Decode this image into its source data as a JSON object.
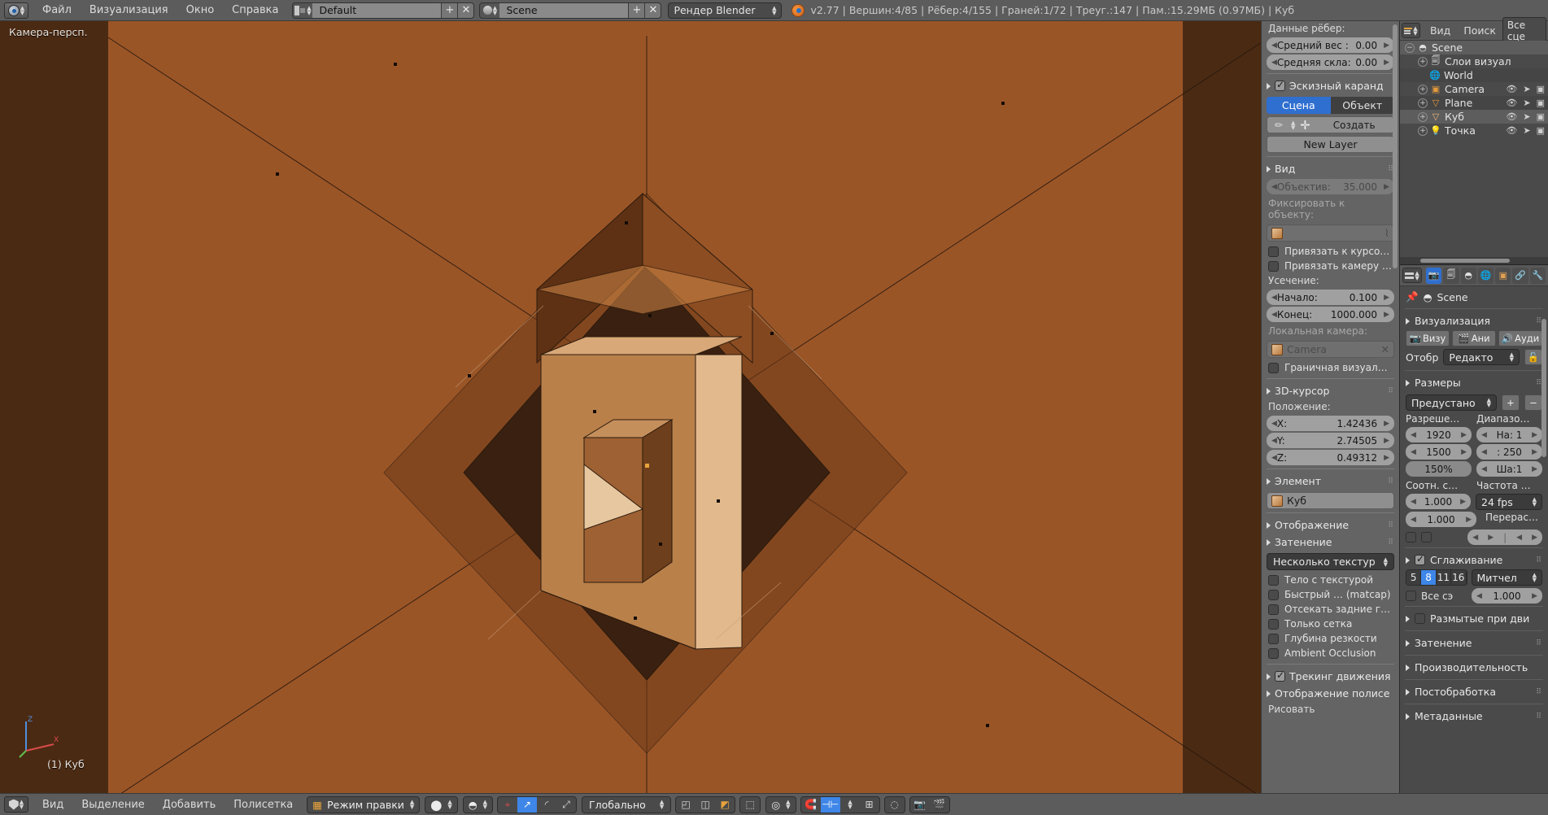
{
  "topbar": {
    "app_icon": "blender-icon",
    "menus": [
      "Файл",
      "Визуализация",
      "Окно",
      "Справка"
    ],
    "screen_layout": {
      "icon": "layout-icon",
      "value": "Default",
      "add": "+",
      "remove": "✕"
    },
    "scene_selector": {
      "icon": "scene-icon",
      "value": "Scene",
      "add": "+",
      "remove": "✕"
    },
    "render_engine": {
      "value": "Рендер Blender",
      "arrow": "⇅"
    },
    "stats": "v2.77 | Вершин:4/85 | Рёбер:4/155 | Граней:1/72 | Треуг.:147 | Пам.:15.29МБ (0.97МБ) | Куб"
  },
  "viewport": {
    "view_label": "Камера-персп.",
    "object_label": "(1) Куб",
    "axis": {
      "x": "X",
      "y": "Y",
      "z": "Z"
    },
    "background_color": "#9a5527",
    "border_color": "#4b2a13"
  },
  "npanel": {
    "edge_data": {
      "title": "Данные рёбер:",
      "mean_weight": {
        "label": "Средний вес :",
        "value": "0.00"
      },
      "mean_crease": {
        "label": "Средняя скла:",
        "value": "0.00"
      }
    },
    "grease_pencil": {
      "title": "Эскизный каранд",
      "checked": true,
      "tabs": [
        "Сцена",
        "Объект"
      ],
      "active_tab": "Сцена",
      "create_label": "Создать",
      "new_layer_label": "New Layer"
    },
    "view": {
      "title": "Вид",
      "lens": {
        "label": "Объектив:",
        "value": "35.000"
      },
      "lock_to_object_label": "Фиксировать к объекту:",
      "lock_object_value": "",
      "lock_to_cursor": "Привязать к курсо…",
      "lock_camera": "Привязать камеру …",
      "clip_title": "Усечение:",
      "clip_start": {
        "label": "Начало:",
        "value": "0.100"
      },
      "clip_end": {
        "label": "Конец:",
        "value": "1000.000"
      },
      "local_camera_label": "Локальная камера:",
      "local_camera_value": "Camera",
      "render_border": "Граничная визуал…"
    },
    "cursor_3d": {
      "title": "3D-курсор",
      "position_label": "Положение:",
      "x": {
        "label": "X:",
        "value": "1.42436"
      },
      "y": {
        "label": "Y:",
        "value": "2.74505"
      },
      "z": {
        "label": "Z:",
        "value": "0.49312"
      }
    },
    "item": {
      "title": "Элемент",
      "name": "Куб"
    },
    "display": {
      "title": "Отображение"
    },
    "shading": {
      "title": "Затенение",
      "mode": "Несколько текстур",
      "options": [
        "Тело с текстурой",
        "Быстрый … (matcap)",
        "Отсекать задние г…",
        "Только сетка",
        "Глубина резкости",
        "Ambient Occlusion"
      ]
    },
    "motion_tracking": {
      "title": "Трекинг движения",
      "checked": true
    },
    "mesh_display": {
      "title": "Отображение полисе",
      "draw_label": "Рисовать"
    }
  },
  "outliner": {
    "header": {
      "view": "Вид",
      "search": "Поиск",
      "filter": "Все сце"
    },
    "rows": [
      {
        "name": "Scene",
        "icon": "scene-icon",
        "indent": 0,
        "expander": "−",
        "selected": true,
        "restrict": false
      },
      {
        "name": "Слои визуал",
        "icon": "renderlayers-icon",
        "indent": 1,
        "expander": "+",
        "selected": false,
        "restrict": false
      },
      {
        "name": "World",
        "icon": "world-icon",
        "indent": 1,
        "expander": "",
        "selected": false,
        "restrict": false
      },
      {
        "name": "Camera",
        "icon": "camera-icon",
        "indent": 1,
        "expander": "+",
        "selected": false,
        "restrict": true
      },
      {
        "name": "Plane",
        "icon": "mesh-icon",
        "indent": 1,
        "expander": "+",
        "selected": false,
        "restrict": true
      },
      {
        "name": "Куб",
        "icon": "mesh-icon",
        "indent": 1,
        "expander": "+",
        "selected": false,
        "restrict": true
      },
      {
        "name": "Точка",
        "icon": "lamp-icon",
        "indent": 1,
        "expander": "+",
        "selected": false,
        "restrict": true
      }
    ]
  },
  "properties": {
    "tabs": [
      "render-tab",
      "renderlayers-tab",
      "scene-tab",
      "world-tab",
      "object-tab",
      "constraints-tab",
      "modifiers-tab"
    ],
    "active_tab_index": 0,
    "breadcrumb": {
      "pin": "pin-icon",
      "scene": "Scene"
    },
    "render": {
      "title": "Визуализация",
      "buttons": [
        "Визу",
        "Ани",
        "Ауди"
      ],
      "display_label": "Отобр",
      "display_value": "Редакто"
    },
    "dimensions": {
      "title": "Размеры",
      "preset": "Предустано",
      "add": "+",
      "remove": "−",
      "resolution_label": "Разреше…",
      "frame_range_label": "Диапазо…",
      "res_x": "1920",
      "res_y": "1500",
      "res_percent": "150%",
      "frame_start": "На: 1",
      "frame_end": ": 250",
      "frame_step": "Ша:1",
      "aspect_label": "Соотн. с…",
      "fps_label": "Частота …",
      "aspect_x": "1.000",
      "aspect_y": "1.000",
      "fps": "24 fps",
      "remap_label": "Перерас…"
    },
    "antialiasing": {
      "title": "Сглаживание",
      "checked": true,
      "samples": [
        "5",
        "8",
        "11",
        "16"
      ],
      "active_sample": "8",
      "filter": "Митчел",
      "full_sample_label": "Все сэ",
      "size": "1.000"
    },
    "sections": [
      {
        "title": "Размытые при дви",
        "has_checkbox": true
      },
      {
        "title": "Затенение",
        "has_checkbox": false
      },
      {
        "title": "Производительность",
        "has_checkbox": false
      },
      {
        "title": "Постобработка",
        "has_checkbox": false
      },
      {
        "title": "Метаданные",
        "has_checkbox": false
      }
    ]
  },
  "bottombar": {
    "menus": [
      "Вид",
      "Выделение",
      "Добавить",
      "Полисетка"
    ],
    "mode": "Режим правки",
    "select_modes": [
      "vertex-select-icon",
      "edge-select-icon",
      "face-select-icon"
    ],
    "pivot": "pivot-icon",
    "snap": "magnet-icon",
    "orientation": "Глобально",
    "proportional": "proportional-edit-icon"
  }
}
